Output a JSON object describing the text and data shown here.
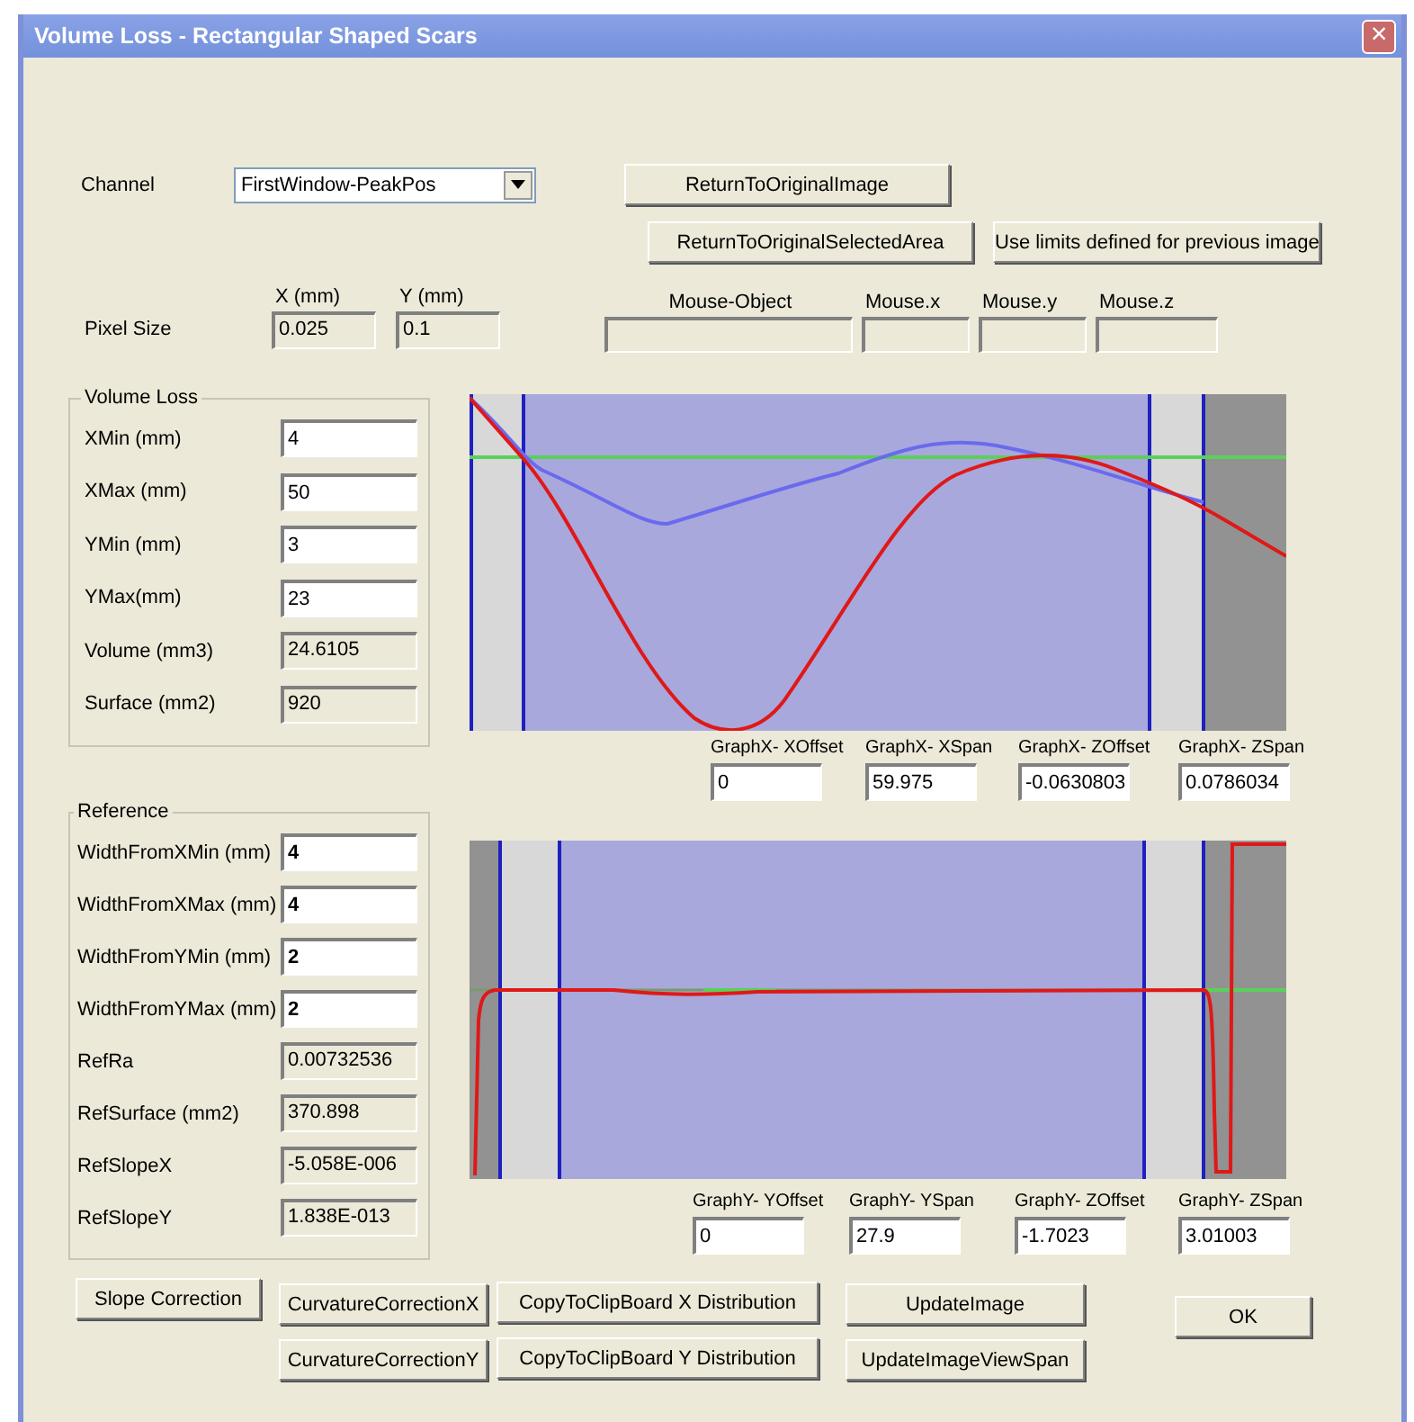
{
  "window": {
    "title": "Volume Loss - Rectangular Shaped Scars",
    "close": "×"
  },
  "channel": {
    "label": "Channel",
    "value": "FirstWindow-PeakPos"
  },
  "top_buttons": [
    "ReturnToOriginalImage",
    "ReturnToOriginalSelectedArea",
    "Use limits defined for previous image"
  ],
  "pixel_size": {
    "label": "Pixel Size",
    "x_label": "X (mm)",
    "x_value": "0.025",
    "y_label": "Y (mm)",
    "y_value": "0.1"
  },
  "mouse_fields": [
    {
      "label": "Mouse-Object"
    },
    {
      "label": "Mouse.x"
    },
    {
      "label": "Mouse.y"
    },
    {
      "label": "Mouse.z"
    }
  ],
  "volume_loss": {
    "title": "Volume Loss",
    "fields": [
      {
        "label": "XMin (mm)",
        "value": "4",
        "kind": "input"
      },
      {
        "label": "XMax (mm)",
        "value": "50",
        "kind": "input"
      },
      {
        "label": "YMin (mm)",
        "value": "3",
        "kind": "input"
      },
      {
        "label": "YMax(mm)",
        "value": "23",
        "kind": "input"
      },
      {
        "label": "Volume (mm3)",
        "value": "24.6105",
        "kind": "readonly"
      },
      {
        "label": "Surface (mm2)",
        "value": "920",
        "kind": "readonly"
      }
    ]
  },
  "reference": {
    "title": "Reference",
    "fields": [
      {
        "label": "WidthFromXMin (mm)",
        "value": "4",
        "kind": "input"
      },
      {
        "label": "WidthFromXMax (mm)",
        "value": "4",
        "kind": "input"
      },
      {
        "label": "WidthFromYMin (mm)",
        "value": "2",
        "kind": "input"
      },
      {
        "label": "WidthFromYMax (mm)",
        "value": "2",
        "kind": "input"
      },
      {
        "label": "RefRa",
        "value": "0.00732536",
        "kind": "readonly"
      },
      {
        "label": "RefSurface (mm2)",
        "value": "370.898",
        "kind": "readonly"
      },
      {
        "label": "RefSlopeX",
        "value": "-5.058E-006",
        "kind": "readonly"
      },
      {
        "label": "RefSlopeY",
        "value": "1.838E-013",
        "kind": "readonly"
      }
    ]
  },
  "graph_x_fields": [
    {
      "label": "GraphX- XOffset",
      "value": "0"
    },
    {
      "label": "GraphX- XSpan",
      "value": "59.975"
    },
    {
      "label": "GraphX- ZOffset",
      "value": "-0.0630803"
    },
    {
      "label": "GraphX- ZSpan",
      "value": "0.0786034"
    }
  ],
  "graph_y_fields": [
    {
      "label": "GraphY- YOffset",
      "value": "0"
    },
    {
      "label": "GraphY- YSpan",
      "value": "27.9"
    },
    {
      "label": "GraphY- ZOffset",
      "value": "-1.7023"
    },
    {
      "label": "GraphY- ZSpan",
      "value": "3.01003"
    }
  ],
  "bottom_buttons": {
    "slope": "Slope Correction",
    "curvature_x": "CurvatureCorrectionX",
    "curvature_y": "CurvatureCorrectionY",
    "copy_x": "CopyToClipBoard X Distribution",
    "copy_y": "CopyToClipBoard Y Distribution",
    "update_image": "UpdateImage",
    "update_view_span": "UpdateImageViewSpan",
    "ok": "OK"
  }
}
